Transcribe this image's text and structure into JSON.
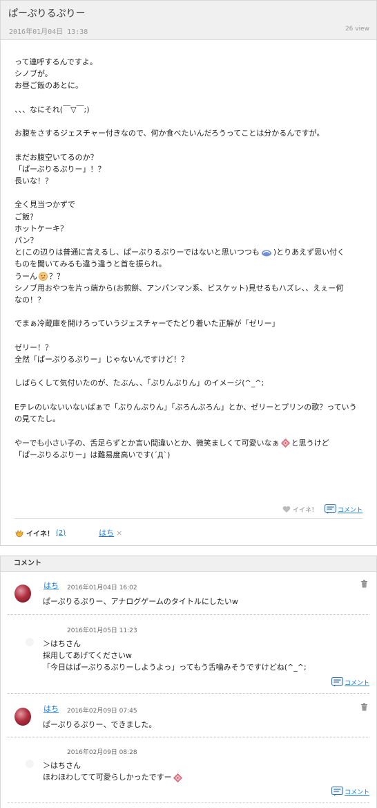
{
  "post": {
    "title": "ぱーぷりるぷりー",
    "date": "2016年01月04日 13:38",
    "views": "26 view",
    "lines": [
      "って連呼するんですよ。",
      "シノブが。",
      "お昼ご飯のあとに。",
      "",
      "、、、なにそれ(￣▽￣;)",
      "",
      "お腹をさするジェスチャー付きなので、何か食べたいんだろうってことは分かるんですが。",
      "",
      "まだお腹空いてるのか？",
      "「ぱーぷりるぷりー」！？",
      "長いな！？",
      "",
      "全く見当つかずで",
      "ご飯？",
      "ホットケーキ？",
      "パン？"
    ],
    "line_emoji1_before": "と(この辺りは普通に言えるし、ぱーぷりるぷりーではないと思いつつも",
    "line_emoji1_after": ")とりあえず思い付く",
    "line_after_emoji1": "ものを聞いてみるも違う違うと首を振られ。",
    "line_emoji2_before": "うーん",
    "line_emoji2_after": "？？",
    "lines2": [
      "シノブ用おやつを片っ端から(お煎餅、アンパンマン系、ビスケット)見せるもハズレ、、えぇー何",
      "なの！？",
      "",
      "でまぁ冷蔵庫を開けろっていうジェスチャーでたどり着いた正解が「ゼリー」",
      "",
      "ゼリー！？",
      "全然「ぱーぷりるぷりー」じゃないんですけど！？",
      "",
      "しばらくして気付いたのが、たぶん、、「ぷりんぷりん」のイメージ(^_^;",
      "",
      "Eテレのいないいないばぁで「ぷりんぷりん」「ぷろんぷろん」とか、ゼリーとプリンの歌？っていう",
      "の見てたし。",
      ""
    ],
    "line_emoji3_before": "やーでも小さい子の、舌足らずとか言い間違いとか、微笑ましくて可愛いなぁ",
    "line_emoji3_after": "と思うけど",
    "last_line": "「ぱーぷりるぷりー」は難易度高いです(´Д`)",
    "like_label": "イイネ！",
    "comment_label": "コメント",
    "iine_label": "イイネ！",
    "iine_count": "(2)",
    "user": "はち",
    "user_x": "×"
  },
  "comments": {
    "header": "コメント",
    "items": [
      {
        "author": "はち",
        "date": "2016年01月04日 16:02",
        "text": "ぱーぷりるぷりー、アナログゲームのタイトルにしたいw"
      },
      {
        "date": "2016年01月05日 11:23",
        "text": "＞はちさん\n採用してあげてくださいw\n「今日はぱーぷりるぷりーしようよっ」ってもう舌噛みそうですけどね(^_^;",
        "reply_label": "コメント"
      },
      {
        "author": "はち",
        "date": "2016年02月09日 07:45",
        "text": "ぱーぷりるぷりー、できました。"
      },
      {
        "date": "2016年02月09日 08:28",
        "text_before": "＞はちさん\nほわほわしてて可愛らしかったですー",
        "reply_label": "コメント"
      }
    ]
  }
}
